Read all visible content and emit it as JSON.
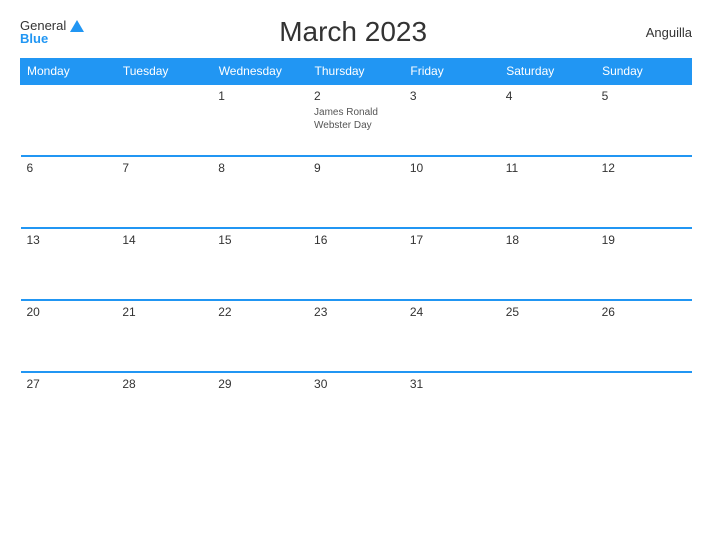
{
  "header": {
    "logo_general": "General",
    "logo_blue": "Blue",
    "title": "March 2023",
    "country": "Anguilla"
  },
  "days_of_week": [
    "Monday",
    "Tuesday",
    "Wednesday",
    "Thursday",
    "Friday",
    "Saturday",
    "Sunday"
  ],
  "weeks": [
    [
      {
        "day": "",
        "empty": true
      },
      {
        "day": "",
        "empty": true
      },
      {
        "day": "1",
        "empty": false,
        "event": ""
      },
      {
        "day": "2",
        "empty": false,
        "event": "James Ronald Webster Day"
      },
      {
        "day": "3",
        "empty": false,
        "event": ""
      },
      {
        "day": "4",
        "empty": false,
        "event": ""
      },
      {
        "day": "5",
        "empty": false,
        "event": ""
      }
    ],
    [
      {
        "day": "6",
        "empty": false,
        "event": ""
      },
      {
        "day": "7",
        "empty": false,
        "event": ""
      },
      {
        "day": "8",
        "empty": false,
        "event": ""
      },
      {
        "day": "9",
        "empty": false,
        "event": ""
      },
      {
        "day": "10",
        "empty": false,
        "event": ""
      },
      {
        "day": "11",
        "empty": false,
        "event": ""
      },
      {
        "day": "12",
        "empty": false,
        "event": ""
      }
    ],
    [
      {
        "day": "13",
        "empty": false,
        "event": ""
      },
      {
        "day": "14",
        "empty": false,
        "event": ""
      },
      {
        "day": "15",
        "empty": false,
        "event": ""
      },
      {
        "day": "16",
        "empty": false,
        "event": ""
      },
      {
        "day": "17",
        "empty": false,
        "event": ""
      },
      {
        "day": "18",
        "empty": false,
        "event": ""
      },
      {
        "day": "19",
        "empty": false,
        "event": ""
      }
    ],
    [
      {
        "day": "20",
        "empty": false,
        "event": ""
      },
      {
        "day": "21",
        "empty": false,
        "event": ""
      },
      {
        "day": "22",
        "empty": false,
        "event": ""
      },
      {
        "day": "23",
        "empty": false,
        "event": ""
      },
      {
        "day": "24",
        "empty": false,
        "event": ""
      },
      {
        "day": "25",
        "empty": false,
        "event": ""
      },
      {
        "day": "26",
        "empty": false,
        "event": ""
      }
    ],
    [
      {
        "day": "27",
        "empty": false,
        "event": ""
      },
      {
        "day": "28",
        "empty": false,
        "event": ""
      },
      {
        "day": "29",
        "empty": false,
        "event": ""
      },
      {
        "day": "30",
        "empty": false,
        "event": ""
      },
      {
        "day": "31",
        "empty": false,
        "event": ""
      },
      {
        "day": "",
        "empty": true
      },
      {
        "day": "",
        "empty": true
      }
    ]
  ],
  "colors": {
    "header_bg": "#2196F3",
    "border_top": "#2196F3"
  }
}
